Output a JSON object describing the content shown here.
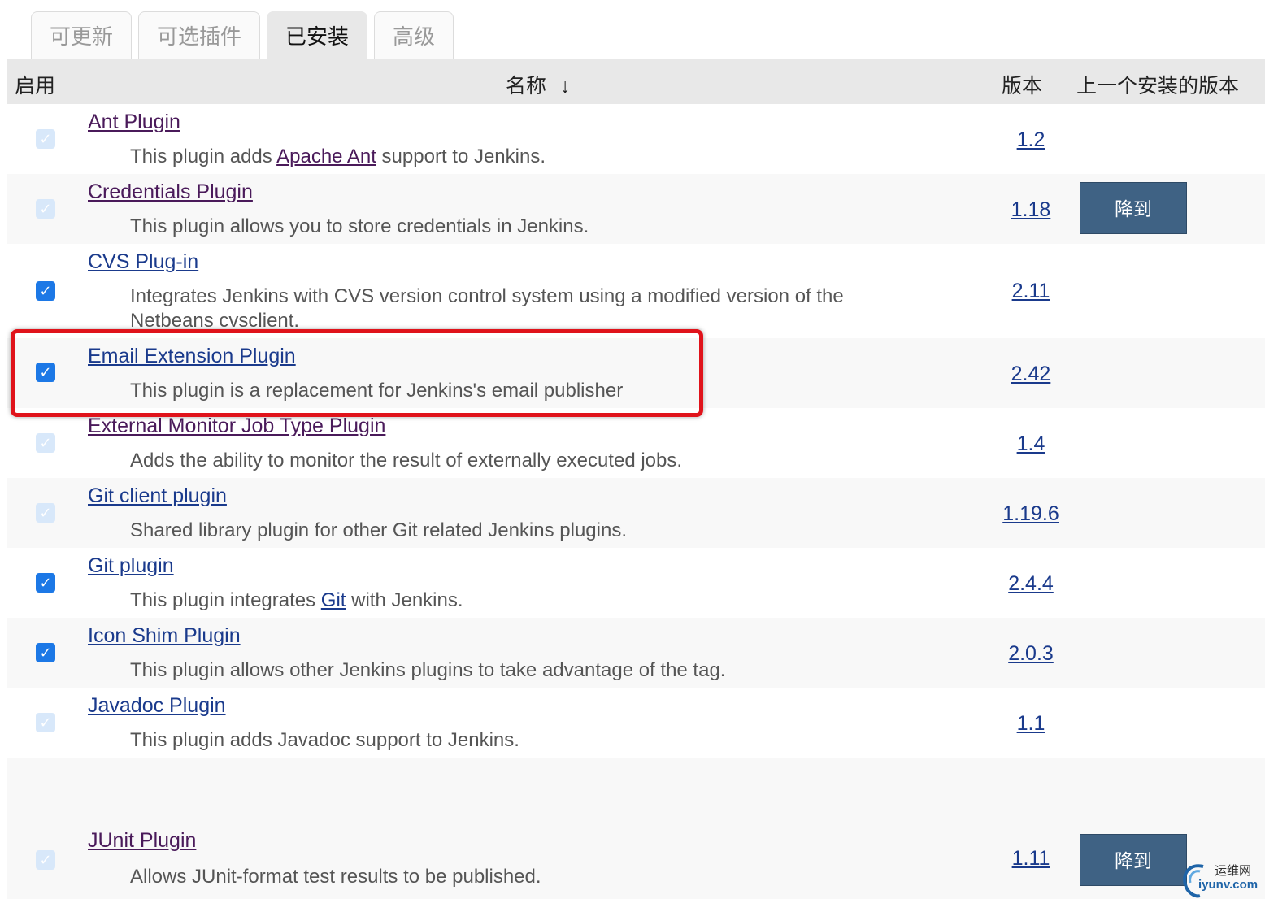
{
  "tabs": [
    "可更新",
    "可选插件",
    "已安装",
    "高级"
  ],
  "active_tab": "已安装",
  "table_header": {
    "enabled": "启用",
    "name": "名称",
    "sort_arrow": "↓",
    "version": "版本",
    "previous_version": "上一个安装的版本"
  },
  "downgrade_label": "降到",
  "plugins": [
    {
      "name": "Ant Plugin",
      "desc_before": "This plugin adds ",
      "desc_link": "Apache Ant",
      "desc_after": " support to Jenkins.",
      "version": "1.2",
      "enabled_state": "disabled-checked"
    },
    {
      "name": "Credentials Plugin",
      "desc_before": "This plugin allows you to store credentials in Jenkins.",
      "desc_link": "",
      "desc_after": "",
      "version": "1.18",
      "enabled_state": "disabled-checked"
    },
    {
      "name": "CVS Plug-in",
      "desc_before": "Integrates Jenkins with CVS version control system using a modified version of the Netbeans cvsclient.",
      "desc_link": "",
      "desc_after": "",
      "version": "2.11",
      "enabled_state": "checked"
    },
    {
      "name": "Email Extension Plugin",
      "desc_before": "This plugin is a replacement for Jenkins's email publisher",
      "desc_link": "",
      "desc_after": "",
      "version": "2.42",
      "enabled_state": "checked"
    },
    {
      "name": "External Monitor Job Type Plugin",
      "desc_before": "Adds the ability to monitor the result of externally executed jobs.",
      "desc_link": "",
      "desc_after": "",
      "version": "1.4",
      "enabled_state": "disabled-checked"
    },
    {
      "name": "Git client plugin",
      "desc_before": "Shared library plugin for other Git related Jenkins plugins.",
      "desc_link": "",
      "desc_after": "",
      "version": "1.19.6",
      "enabled_state": "disabled-checked"
    },
    {
      "name": "Git plugin",
      "desc_before": "This plugin integrates ",
      "desc_link": "Git",
      "desc_after": " with Jenkins.",
      "version": "2.4.4",
      "enabled_state": "checked"
    },
    {
      "name": "Icon Shim Plugin",
      "desc_before": "This plugin allows other Jenkins plugins to take advantage of the tag.",
      "desc_link": "",
      "desc_after": "",
      "version": "2.0.3",
      "enabled_state": "checked"
    },
    {
      "name": "Javadoc Plugin",
      "desc_before": "This plugin adds Javadoc support to Jenkins.",
      "desc_link": "",
      "desc_after": "",
      "version": "1.1",
      "enabled_state": "disabled-checked"
    },
    {
      "name": "JUnit Plugin",
      "desc_before": "Allows JUnit-format test results to be published.",
      "desc_link": "",
      "desc_after": "",
      "version": "1.11",
      "enabled_state": "disabled-checked"
    }
  ],
  "watermark": {
    "cn": "运维网",
    "url": "iyunv.com"
  },
  "colors": {
    "highlight": "#e0131b",
    "downgrade_button": "#3f6284",
    "checkbox": "#1c78e6",
    "link": "#1a3a8c",
    "visited_link": "#4a1a5a"
  }
}
